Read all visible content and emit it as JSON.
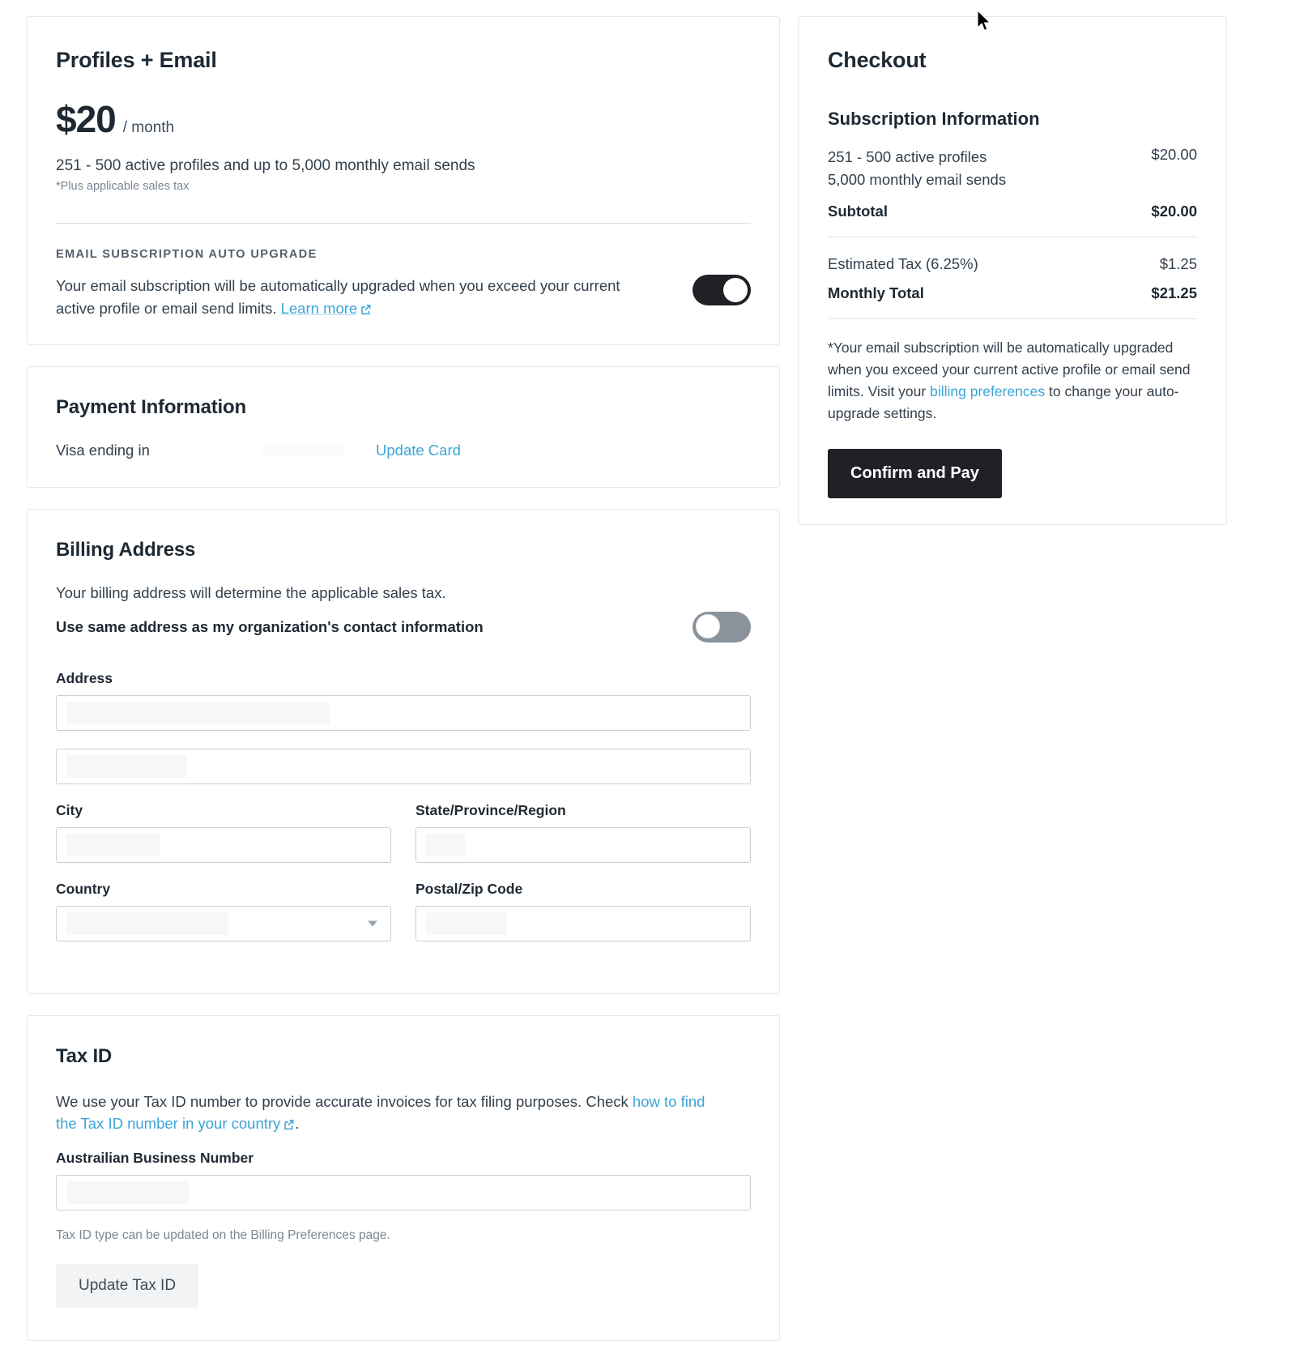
{
  "plan": {
    "title": "Profiles + Email",
    "price_amount": "$20",
    "price_period": "/ month",
    "description": "251 - 500 active profiles and up to 5,000 monthly email sends",
    "tax_note": "*Plus applicable sales tax",
    "auto_upgrade_eyebrow": "EMAIL SUBSCRIPTION AUTO UPGRADE",
    "auto_upgrade_text": "Your email subscription will be automatically upgraded when you exceed your current active profile or email send limits.",
    "learn_more_label": "Learn more",
    "auto_upgrade_toggle_state": "on"
  },
  "payment": {
    "title": "Payment Information",
    "card_label": "Visa ending in",
    "card_last4": "",
    "update_card_label": "Update Card"
  },
  "billing": {
    "title": "Billing Address",
    "description": "Your billing address will determine the applicable sales tax.",
    "same_address_label": "Use same address as my organization's contact information",
    "same_address_toggle_state": "off",
    "fields": {
      "address_label": "Address",
      "address_line1_value": "",
      "address_line2_value": "",
      "city_label": "City",
      "city_value": "",
      "state_label": "State/Province/Region",
      "state_value": "",
      "country_label": "Country",
      "country_value": "",
      "postal_label": "Postal/Zip Code",
      "postal_value": ""
    }
  },
  "tax_id": {
    "title": "Tax ID",
    "description_part1": "We use your Tax ID number to provide accurate invoices for tax filing purposes. Check ",
    "link_label": "how to find the Tax ID number in your country",
    "description_part2": ".",
    "field_label": "Austrailian Business Number",
    "field_value": "",
    "note": "Tax ID type can be updated on the Billing Preferences page.",
    "update_button_label": "Update Tax ID"
  },
  "checkout": {
    "title": "Checkout",
    "subscription_title": "Subscription Information",
    "items": [
      {
        "desc_line1": "251 - 500 active profiles",
        "desc_line2": "5,000 monthly email sends",
        "amount": "$20.00"
      }
    ],
    "subtotal_label": "Subtotal",
    "subtotal_amount": "$20.00",
    "tax_label": "Estimated Tax (6.25%)",
    "tax_amount": "$1.25",
    "total_label": "Monthly Total",
    "total_amount": "$21.25",
    "disclaimer_part1": "*Your email subscription will be automatically upgraded when you exceed your current active profile or email send limits. Visit your ",
    "disclaimer_link": "billing preferences",
    "disclaimer_part2": " to change your auto-upgrade settings.",
    "confirm_button_label": "Confirm and Pay"
  },
  "colors": {
    "link": "#3ba4d6",
    "primary_button_bg": "#1f2126",
    "toggle_on": "#1f2126",
    "toggle_off": "#8a929b"
  }
}
